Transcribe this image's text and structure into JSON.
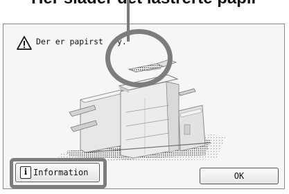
{
  "banner": {
    "text": "Hér sláder det lastrerte papir"
  },
  "dialog": {
    "message": "Der er papirst",
    "message_suffix": "y.",
    "warning_icon": "warning-triangle-icon"
  },
  "buttons": {
    "information_label": "Information",
    "information_icon": "info-icon",
    "ok_label": "OK"
  },
  "colors": {
    "callout": "#7d7d7d",
    "dialog_border": "#888888"
  }
}
